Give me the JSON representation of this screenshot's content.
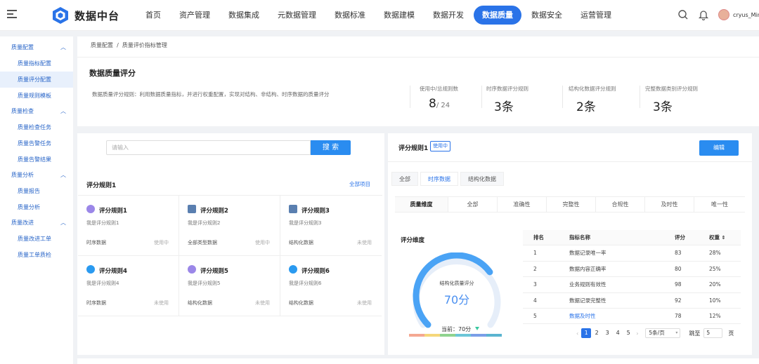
{
  "header": {
    "app_title": "数据中台",
    "nav": [
      "首页",
      "资产管理",
      "数据集成",
      "元数据管理",
      "数据标准",
      "数据建模",
      "数据开发",
      "数据质量",
      "数据安全",
      "运营管理"
    ],
    "active_nav": "数据质量",
    "username": "cryus_Min",
    "icons": [
      "menu-icon",
      "logo-icon",
      "search-icon",
      "bell-icon",
      "avatar"
    ]
  },
  "sidebar": {
    "groups": [
      {
        "label": "质量配置",
        "items": [
          "质量指标配置",
          "质量评分配置",
          "质量规则模板"
        ]
      },
      {
        "label": "质量检查",
        "items": [
          "质量检查任务",
          "质量告警任务",
          "质量告警结果"
        ]
      },
      {
        "label": "质量分析",
        "items": [
          "质量报告",
          "质量分析"
        ]
      },
      {
        "label": "质量改进",
        "items": [
          "质量改进工单",
          "质量工单质检"
        ]
      }
    ],
    "active_item": "质量评分配置"
  },
  "breadcrumb": {
    "a": "质量配置",
    "sep": "/",
    "b": "质量评价指标管理"
  },
  "page": {
    "title": "数据质量评分",
    "description": "数据质量评分规则：利用数据质量指标，并进行权重配置，实现对结构、非结构、时序数据的质量评分"
  },
  "stats": [
    {
      "label": "使用中/总规则数",
      "value": "8",
      "suffix": "/ 24"
    },
    {
      "label": "时序数据评分规则",
      "value": "3条",
      "suffix": ""
    },
    {
      "label": "结构化数据评分规则",
      "value": "2条",
      "suffix": ""
    },
    {
      "label": "完整数据类别评分规则",
      "value": "3条",
      "suffix": ""
    }
  ],
  "search": {
    "placeholder": "请输入",
    "button": "搜 索"
  },
  "rules": {
    "title": "评分规则1",
    "all_link": "全部项目",
    "cards": [
      {
        "name": "评分规则1",
        "desc": "我是评分规则1",
        "type": "时序数据",
        "status": "使用中",
        "icon_color": "#9b87e8"
      },
      {
        "name": "评分规则2",
        "desc": "我是评分规则2",
        "type": "全部类型数据",
        "status": "使用中",
        "icon_color": "#5a7fb0"
      },
      {
        "name": "评分规则3",
        "desc": "我是评分规则3",
        "type": "结构化数据",
        "status": "未使用",
        "icon_color": "#5a7fb0"
      },
      {
        "name": "评分规则4",
        "desc": "我是评分规则4",
        "type": "时序数据",
        "status": "未使用",
        "icon_color": "#2a9af0"
      },
      {
        "name": "评分规则5",
        "desc": "我是评分规则5",
        "type": "结构化数据",
        "status": "未使用",
        "icon_color": "#9b87e8"
      },
      {
        "name": "评分规则6",
        "desc": "我是评分规则6",
        "type": "结构化数据",
        "status": "未使用",
        "icon_color": "#2a9af0"
      }
    ]
  },
  "detail": {
    "title": "评分规则1",
    "badge": "使用中",
    "edit": "编辑",
    "tabs": [
      "全部",
      "时序数据",
      "结构化数据"
    ],
    "active_tab": "时序数据",
    "dim_header": "质量维度",
    "dims": [
      "全部",
      "准确性",
      "完整性",
      "合规性",
      "及时性",
      "唯一性"
    ],
    "gauge_title": "评分维度",
    "gauge_label": "结构化质量评分",
    "gauge_value": "70分",
    "gauge_score": 70,
    "gauge_max": 100,
    "current_label": "当前：70分",
    "scale_colors": [
      "#f4a892",
      "#f5d77a",
      "#8fd38f",
      "#6cc6d8",
      "#7a9ee8",
      "#5ab4d0"
    ],
    "table": {
      "headers": [
        "排名",
        "指标名称",
        "评分",
        "权重"
      ],
      "rows": [
        [
          "1",
          "数据记录唯一率",
          "83",
          "28%"
        ],
        [
          "2",
          "数据内容正确率",
          "80",
          "25%"
        ],
        [
          "3",
          "业务规则有效性",
          "98",
          "20%"
        ],
        [
          "4",
          "数据记录完整性",
          "92",
          "10%"
        ],
        [
          "5",
          "数据及时性",
          "78",
          "12%"
        ]
      ]
    },
    "pager": {
      "pages": [
        "1",
        "2",
        "3",
        "4",
        "5"
      ],
      "size": "5条/页",
      "jump": "跳至",
      "jump_value": "5",
      "unit": "页"
    }
  }
}
